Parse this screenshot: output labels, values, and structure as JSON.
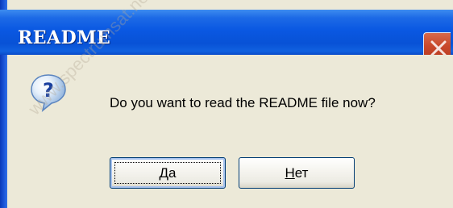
{
  "dialog": {
    "title": "README",
    "message": "Do you want to read the README file now?",
    "icon": "question-icon",
    "close_icon": "close-icon",
    "colors": {
      "titlebar": "#0a58e2",
      "body": "#ece9d8",
      "close": "#c8482b"
    }
  },
  "buttons": {
    "yes": {
      "accel": "Д",
      "rest": "а"
    },
    "no": {
      "accel": "Н",
      "rest": "ет"
    }
  },
  "watermark": "www.spectrumsat.net"
}
